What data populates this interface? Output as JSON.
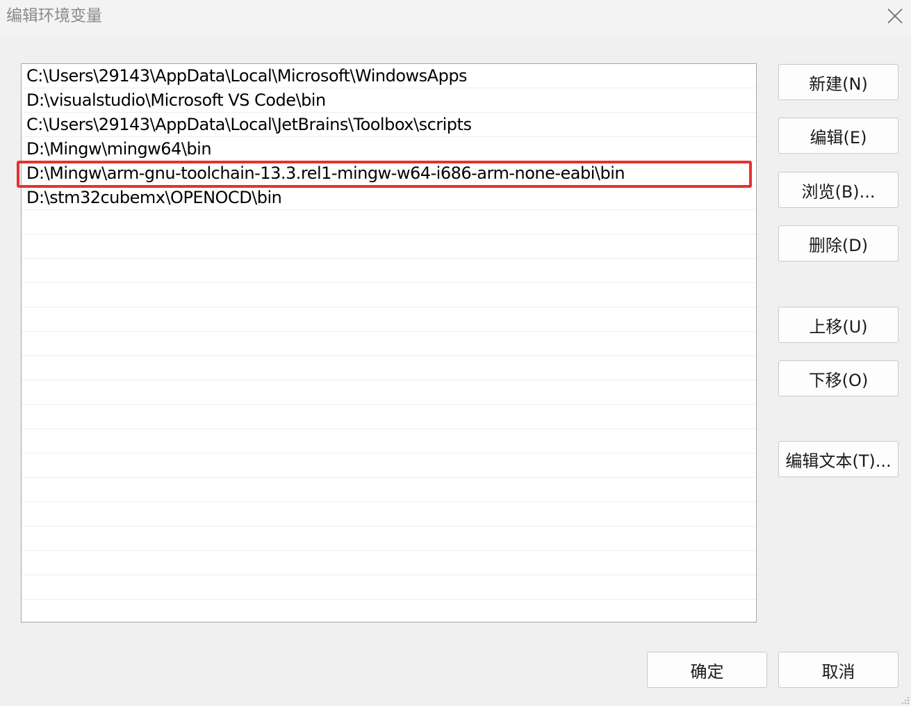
{
  "window": {
    "title": "编辑环境变量",
    "close_icon": "close-icon"
  },
  "path_list": {
    "items": [
      "C:\\Users\\29143\\AppData\\Local\\Microsoft\\WindowsApps",
      "D:\\visualstudio\\Microsoft VS Code\\bin",
      "C:\\Users\\29143\\AppData\\Local\\JetBrains\\Toolbox\\scripts",
      "D:\\Mingw\\mingw64\\bin",
      "D:\\Mingw\\arm-gnu-toolchain-13.3.rel1-mingw-w64-i686-arm-none-eabi\\bin",
      "D:\\stm32cubemx\\OPENOCD\\bin"
    ],
    "highlighted_index": 4,
    "highlight_color": "#e5322d"
  },
  "buttons": {
    "new": "新建(N)",
    "edit": "编辑(E)",
    "browse": "浏览(B)...",
    "delete": "删除(D)",
    "move_up": "上移(U)",
    "move_down": "下移(O)",
    "edit_text": "编辑文本(T)...",
    "ok": "确定",
    "cancel": "取消"
  }
}
